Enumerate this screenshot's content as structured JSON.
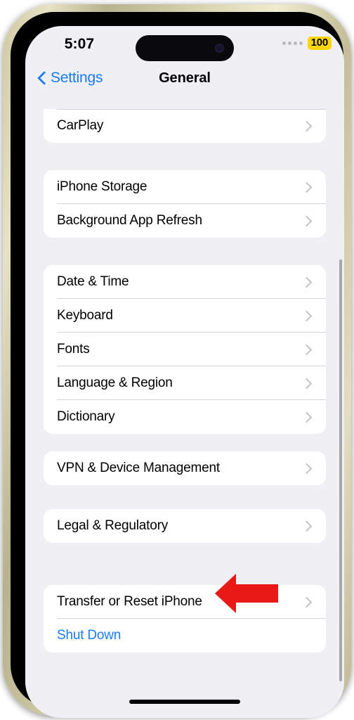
{
  "status_bar": {
    "time": "5:07",
    "signal_dots": 4,
    "battery_level": "100",
    "battery_badge_color": "#ffd60a",
    "camera_icon": "front-camera-dot"
  },
  "nav_bar": {
    "back_label": "Settings",
    "back_icon": "chevron-left-icon",
    "title": "General",
    "tint_color": "#1a7bf0"
  },
  "list": {
    "background_color": "#f0eff4",
    "card_color": "#ffffff",
    "chevron_icon": "chevron-right-icon",
    "groups": [
      {
        "clipped_top": true,
        "rows": [
          {
            "label": "CarPlay",
            "accessory": "chevron",
            "style": "default"
          }
        ]
      },
      {
        "clipped_top": false,
        "rows": [
          {
            "label": "iPhone Storage",
            "accessory": "chevron",
            "style": "default"
          },
          {
            "label": "Background App Refresh",
            "accessory": "chevron",
            "style": "default"
          }
        ]
      },
      {
        "clipped_top": false,
        "rows": [
          {
            "label": "Date & Time",
            "accessory": "chevron",
            "style": "default"
          },
          {
            "label": "Keyboard",
            "accessory": "chevron",
            "style": "default"
          },
          {
            "label": "Fonts",
            "accessory": "chevron",
            "style": "default"
          },
          {
            "label": "Language & Region",
            "accessory": "chevron",
            "style": "default"
          },
          {
            "label": "Dictionary",
            "accessory": "chevron",
            "style": "default"
          }
        ]
      },
      {
        "clipped_top": false,
        "rows": [
          {
            "label": "VPN & Device Management",
            "accessory": "chevron",
            "style": "default"
          }
        ]
      },
      {
        "clipped_top": false,
        "rows": [
          {
            "label": "Legal & Regulatory",
            "accessory": "chevron",
            "style": "default"
          }
        ]
      },
      {
        "clipped_top": false,
        "rows": [
          {
            "label": "Transfer or Reset iPhone",
            "accessory": "chevron",
            "style": "default"
          },
          {
            "label": "Shut Down",
            "accessory": "none",
            "style": "link"
          }
        ]
      }
    ]
  },
  "annotation": {
    "type": "arrow",
    "direction": "left",
    "color": "#e81a17",
    "points_at": "Transfer or Reset iPhone"
  },
  "scroll_indicator": {
    "color": "#a6a6a9"
  },
  "home_indicator": {
    "color": "#000000"
  }
}
